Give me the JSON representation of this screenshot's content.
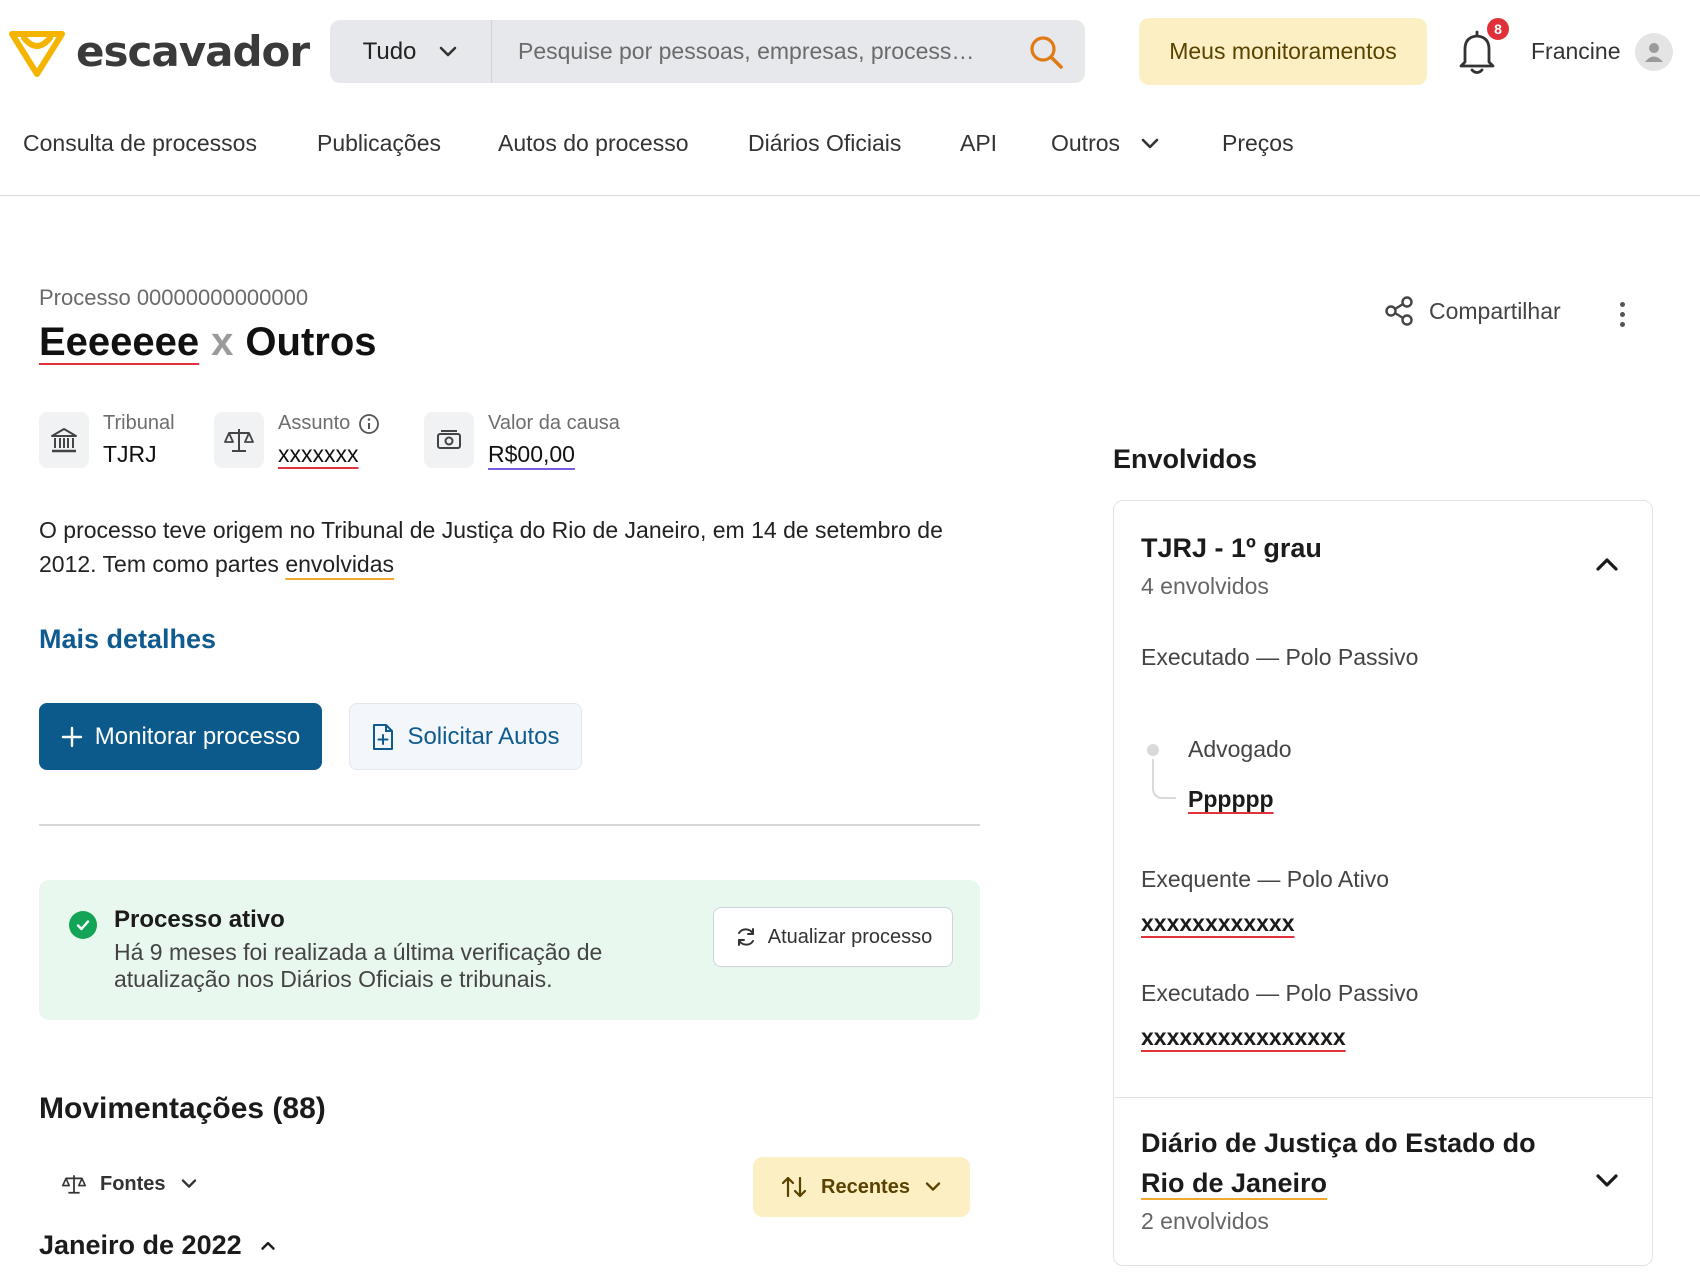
{
  "brand": {
    "name": "escavador"
  },
  "search": {
    "scope": "Tudo",
    "placeholder": "Pesquise por pessoas, empresas, process…"
  },
  "header": {
    "monitor_button": "Meus monitoramentos",
    "notifications_count": "8",
    "user_name": "Francine"
  },
  "nav": {
    "items": [
      {
        "label": "Consulta de processos"
      },
      {
        "label": "Publicações"
      },
      {
        "label": "Autos do processo"
      },
      {
        "label": "Diários Oficiais"
      },
      {
        "label": "API"
      },
      {
        "label": "Outros"
      },
      {
        "label": "Preços"
      }
    ]
  },
  "process": {
    "number": "Processo 00000000000000",
    "party_a": "Eeeeeee",
    "versus": "x",
    "party_b": "Outros",
    "share_label": "Compartilhar",
    "meta": {
      "court_label": "Tribunal",
      "court_value": "TJRJ",
      "subject_label": "Assunto",
      "subject_value": "xxxxxxx",
      "value_label": "Valor da causa",
      "value_value": "R$00,00"
    },
    "description_main": "O processo teve origem no Tribunal de Justiça do Rio de Janeiro, em 14 de setembro de 2012. Tem como partes ",
    "description_link": "envolvidas",
    "more_details": "Mais detalhes",
    "monitor_button": "Monitorar processo",
    "request_button": "Solicitar Autos"
  },
  "status": {
    "title": "Processo ativo",
    "description": "Há 9 meses foi realizada a última verificação de atualização nos Diários Oficiais e tribunais.",
    "update_button": "Atualizar processo"
  },
  "movements": {
    "title": "Movimentações (88)",
    "sources_label": "Fontes",
    "sort_label": "Recentes",
    "month": "Janeiro de 2022"
  },
  "involved": {
    "heading": "Envolvidos",
    "sections": [
      {
        "title": "TJRJ - 1º grau",
        "count": "4 envolvidos",
        "entries": [
          {
            "role": "Executado — Polo Passivo",
            "lawyer_role": "Advogado",
            "lawyer_name": "Pppppp"
          },
          {
            "role": "Exequente — Polo Ativo",
            "name": "xxxxxxxxxxxx"
          },
          {
            "role": "Executado — Polo Passivo",
            "name": "xxxxxxxxxxxxxxxx"
          }
        ]
      },
      {
        "title_line1": "Diário de Justiça do Estado do",
        "title_line2": "Rio de Janeiro",
        "count": "2 envolvidos"
      }
    ]
  },
  "colors": {
    "primary": "#0c5a8c",
    "accent_yellow": "#fbefc3",
    "logo_yellow": "#f4b400",
    "success": "#14a457",
    "badge_red": "#e0313a"
  }
}
